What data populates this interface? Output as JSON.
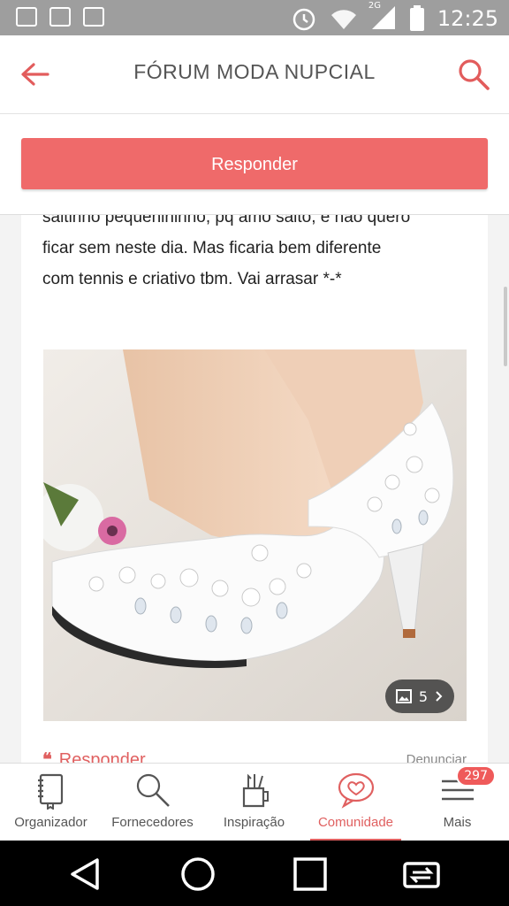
{
  "status": {
    "time": "12:25",
    "net_label": "2G"
  },
  "header": {
    "title": "FÓRUM MODA NUPCIAL"
  },
  "reply_button": "Responder",
  "post": {
    "lines": [
      "saltinho pequenininho, pq amo salto, e não quero",
      "ficar sem neste dia. Mas ficaria bem diferente",
      "com tennis e criativo tbm. Vai arrasar *-*"
    ],
    "gallery_count": "5",
    "reply_label": "Responder",
    "report_label": "Denunciar"
  },
  "bottom_nav": {
    "items": [
      {
        "label": "Organizador",
        "icon": "notebook-icon"
      },
      {
        "label": "Fornecedores",
        "icon": "search-icon"
      },
      {
        "label": "Inspiração",
        "icon": "pencil-cup-icon"
      },
      {
        "label": "Comunidade",
        "icon": "heart-chat-icon"
      },
      {
        "label": "Mais",
        "icon": "menu-icon"
      }
    ],
    "active": "Comunidade",
    "badge": "297"
  },
  "colors": {
    "accent": "#ef6a6a",
    "status_bar": "#9e9e9e"
  }
}
